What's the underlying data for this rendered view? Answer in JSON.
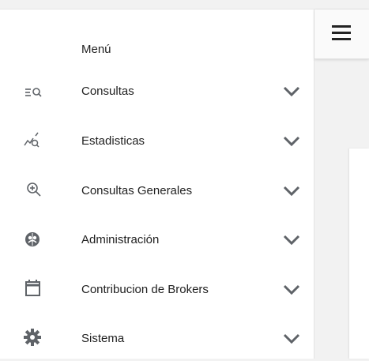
{
  "sidebar": {
    "title": "Menú",
    "items": [
      {
        "label": "Consultas",
        "icon": "list-search-icon"
      },
      {
        "label": "Estadisticas",
        "icon": "chart-search-icon"
      },
      {
        "label": "Consultas Generales",
        "icon": "zoom-in-icon"
      },
      {
        "label": "Administración",
        "icon": "admin-circle-icon"
      },
      {
        "label": "Contribucion de Brokers",
        "icon": "calendar-icon"
      },
      {
        "label": "Sistema",
        "icon": "gear-icon"
      }
    ]
  },
  "topbar": {
    "menu_icon": "hamburger-menu-icon"
  }
}
